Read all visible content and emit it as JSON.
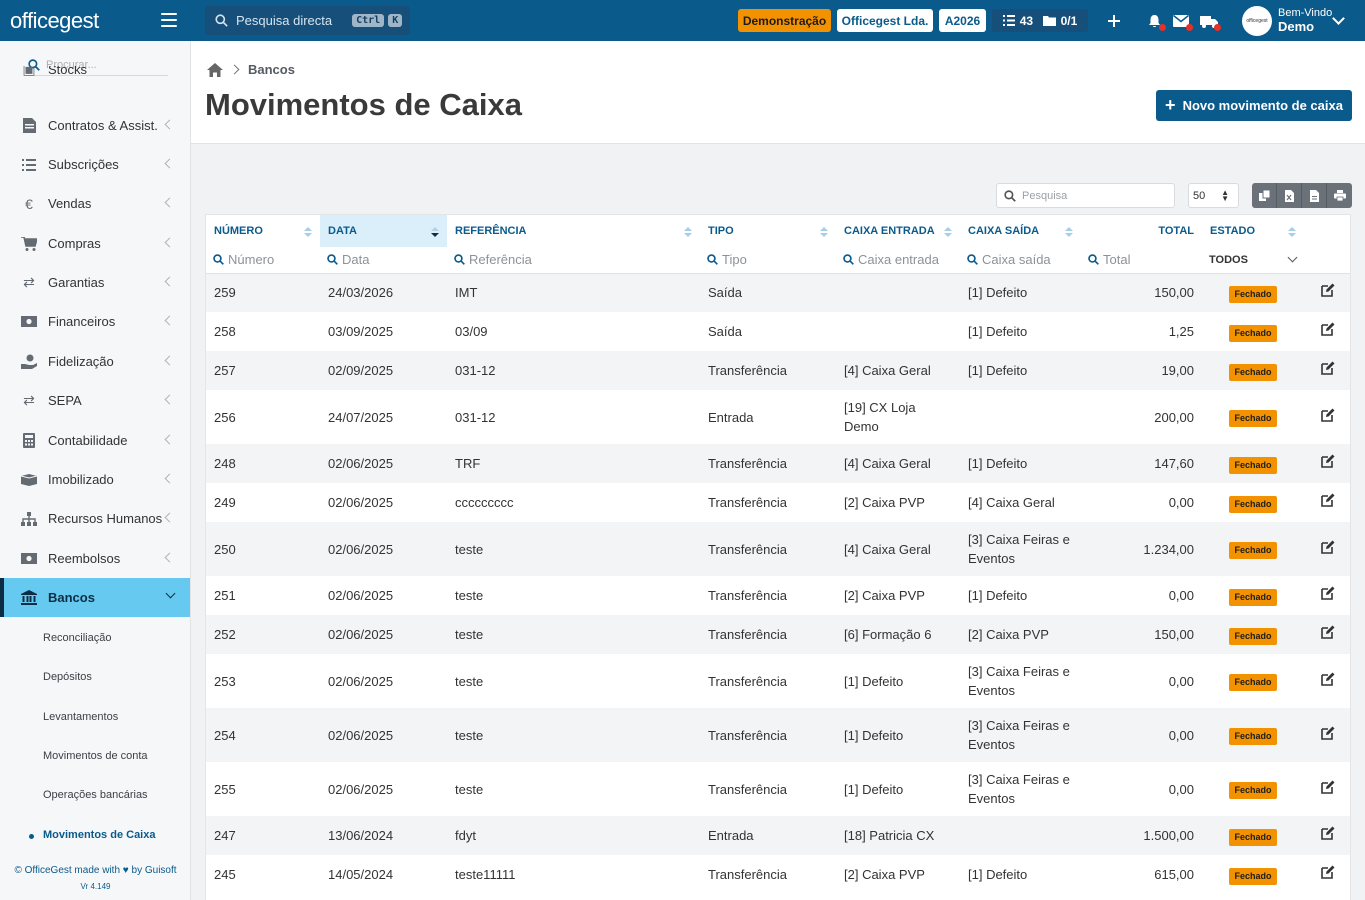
{
  "topbar": {
    "logo": "officegest",
    "search_placeholder": "Pesquisa directa",
    "kbd_ctrl": "Ctrl",
    "kbd_k": "K",
    "demo_label": "Demonstração",
    "company": "Officegest Lda.",
    "year": "A2026",
    "tasks_count": "43",
    "docs_count": "0/1",
    "welcome": "Bem-Vindo",
    "user_name": "Demo",
    "avatar_label": "officegest"
  },
  "sidebar": {
    "search_placeholder": "Procurar...",
    "items": [
      {
        "label": "Stocks",
        "icon": "box-icon"
      },
      {
        "label": "Contratos & Assist.",
        "icon": "contract-icon"
      },
      {
        "label": "Subscrições",
        "icon": "list-icon"
      },
      {
        "label": "Vendas",
        "icon": "euro-icon"
      },
      {
        "label": "Compras",
        "icon": "cart-icon"
      },
      {
        "label": "Garantias",
        "icon": "exchange-icon"
      },
      {
        "label": "Financeiros",
        "icon": "money-icon"
      },
      {
        "label": "Fidelização",
        "icon": "hand-coin-icon"
      },
      {
        "label": "SEPA",
        "icon": "exchange-icon"
      },
      {
        "label": "Contabilidade",
        "icon": "calculator-icon"
      },
      {
        "label": "Imobilizado",
        "icon": "boxes-icon"
      },
      {
        "label": "Recursos Humanos",
        "icon": "org-chart-icon"
      },
      {
        "label": "Reembolsos",
        "icon": "money-icon"
      },
      {
        "label": "Bancos",
        "icon": "bank-icon"
      }
    ],
    "subitems": [
      "Reconciliação",
      "Depósitos",
      "Levantamentos",
      "Movimentos de conta",
      "Operações bancárias",
      "Movimentos de Caixa"
    ],
    "footer_prefix": "© OfficeGest made with",
    "footer_suffix": "by Guisoft",
    "version": "Vr 4.149"
  },
  "page": {
    "breadcrumb": "Bancos",
    "title": "Movimentos de Caixa",
    "new_button": "Novo movimento de caixa",
    "search_placeholder": "Pesquisa",
    "page_size": "50"
  },
  "table": {
    "columns": [
      "NÚMERO",
      "DATA",
      "REFERÊNCIA",
      "TIPO",
      "CAIXA ENTRADA",
      "CAIXA SAÍDA",
      "TOTAL",
      "ESTADO"
    ],
    "filters": [
      "Número",
      "Data",
      "Referência",
      "Tipo",
      "Caixa entrada",
      "Caixa saída",
      "Total",
      "TODOS"
    ],
    "rows": [
      {
        "numero": "259",
        "data": "24/03/2026",
        "referencia": "IMT",
        "tipo": "Saída",
        "entrada": "",
        "saida": "[1] Defeito",
        "total": "150,00",
        "estado": "Fechado"
      },
      {
        "numero": "258",
        "data": "03/09/2025",
        "referencia": "03/09",
        "tipo": "Saída",
        "entrada": "",
        "saida": "[1] Defeito",
        "total": "1,25",
        "estado": "Fechado"
      },
      {
        "numero": "257",
        "data": "02/09/2025",
        "referencia": "031-12",
        "tipo": "Transferência",
        "entrada": "[4] Caixa Geral",
        "saida": "[1] Defeito",
        "total": "19,00",
        "estado": "Fechado"
      },
      {
        "numero": "256",
        "data": "24/07/2025",
        "referencia": "031-12",
        "tipo": "Entrada",
        "entrada": "[19] CX Loja Demo",
        "saida": "",
        "total": "200,00",
        "estado": "Fechado"
      },
      {
        "numero": "248",
        "data": "02/06/2025",
        "referencia": "TRF",
        "tipo": "Transferência",
        "entrada": "[4] Caixa Geral",
        "saida": "[1] Defeito",
        "total": "147,60",
        "estado": "Fechado"
      },
      {
        "numero": "249",
        "data": "02/06/2025",
        "referencia": "ccccccccc",
        "tipo": "Transferência",
        "entrada": "[2] Caixa PVP",
        "saida": "[4] Caixa Geral",
        "total": "0,00",
        "estado": "Fechado"
      },
      {
        "numero": "250",
        "data": "02/06/2025",
        "referencia": "teste",
        "tipo": "Transferência",
        "entrada": "[4] Caixa Geral",
        "saida": "[3] Caixa Feiras e Eventos",
        "total": "1.234,00",
        "estado": "Fechado"
      },
      {
        "numero": "251",
        "data": "02/06/2025",
        "referencia": "teste",
        "tipo": "Transferência",
        "entrada": "[2] Caixa PVP",
        "saida": "[1] Defeito",
        "total": "0,00",
        "estado": "Fechado"
      },
      {
        "numero": "252",
        "data": "02/06/2025",
        "referencia": "teste",
        "tipo": "Transferência",
        "entrada": "[6] Formação 6",
        "saida": "[2] Caixa PVP",
        "total": "150,00",
        "estado": "Fechado"
      },
      {
        "numero": "253",
        "data": "02/06/2025",
        "referencia": "teste",
        "tipo": "Transferência",
        "entrada": "[1] Defeito",
        "saida": "[3] Caixa Feiras e Eventos",
        "total": "0,00",
        "estado": "Fechado"
      },
      {
        "numero": "254",
        "data": "02/06/2025",
        "referencia": "teste",
        "tipo": "Transferência",
        "entrada": "[1] Defeito",
        "saida": "[3] Caixa Feiras e Eventos",
        "total": "0,00",
        "estado": "Fechado"
      },
      {
        "numero": "255",
        "data": "02/06/2025",
        "referencia": "teste",
        "tipo": "Transferência",
        "entrada": "[1] Defeito",
        "saida": "[3] Caixa Feiras e Eventos",
        "total": "0,00",
        "estado": "Fechado"
      },
      {
        "numero": "247",
        "data": "13/06/2024",
        "referencia": "fdyt",
        "tipo": "Entrada",
        "entrada": "[18] Patricia CX",
        "saida": "",
        "total": "1.500,00",
        "estado": "Fechado"
      },
      {
        "numero": "245",
        "data": "14/05/2024",
        "referencia": "teste11111",
        "tipo": "Transferência",
        "entrada": "[2] Caixa PVP",
        "saida": "[1] Defeito",
        "total": "615,00",
        "estado": "Fechado"
      }
    ]
  },
  "colors": {
    "primary": "#0a5a8c",
    "accent": "#f39200",
    "active_nav": "#66c9ef"
  }
}
